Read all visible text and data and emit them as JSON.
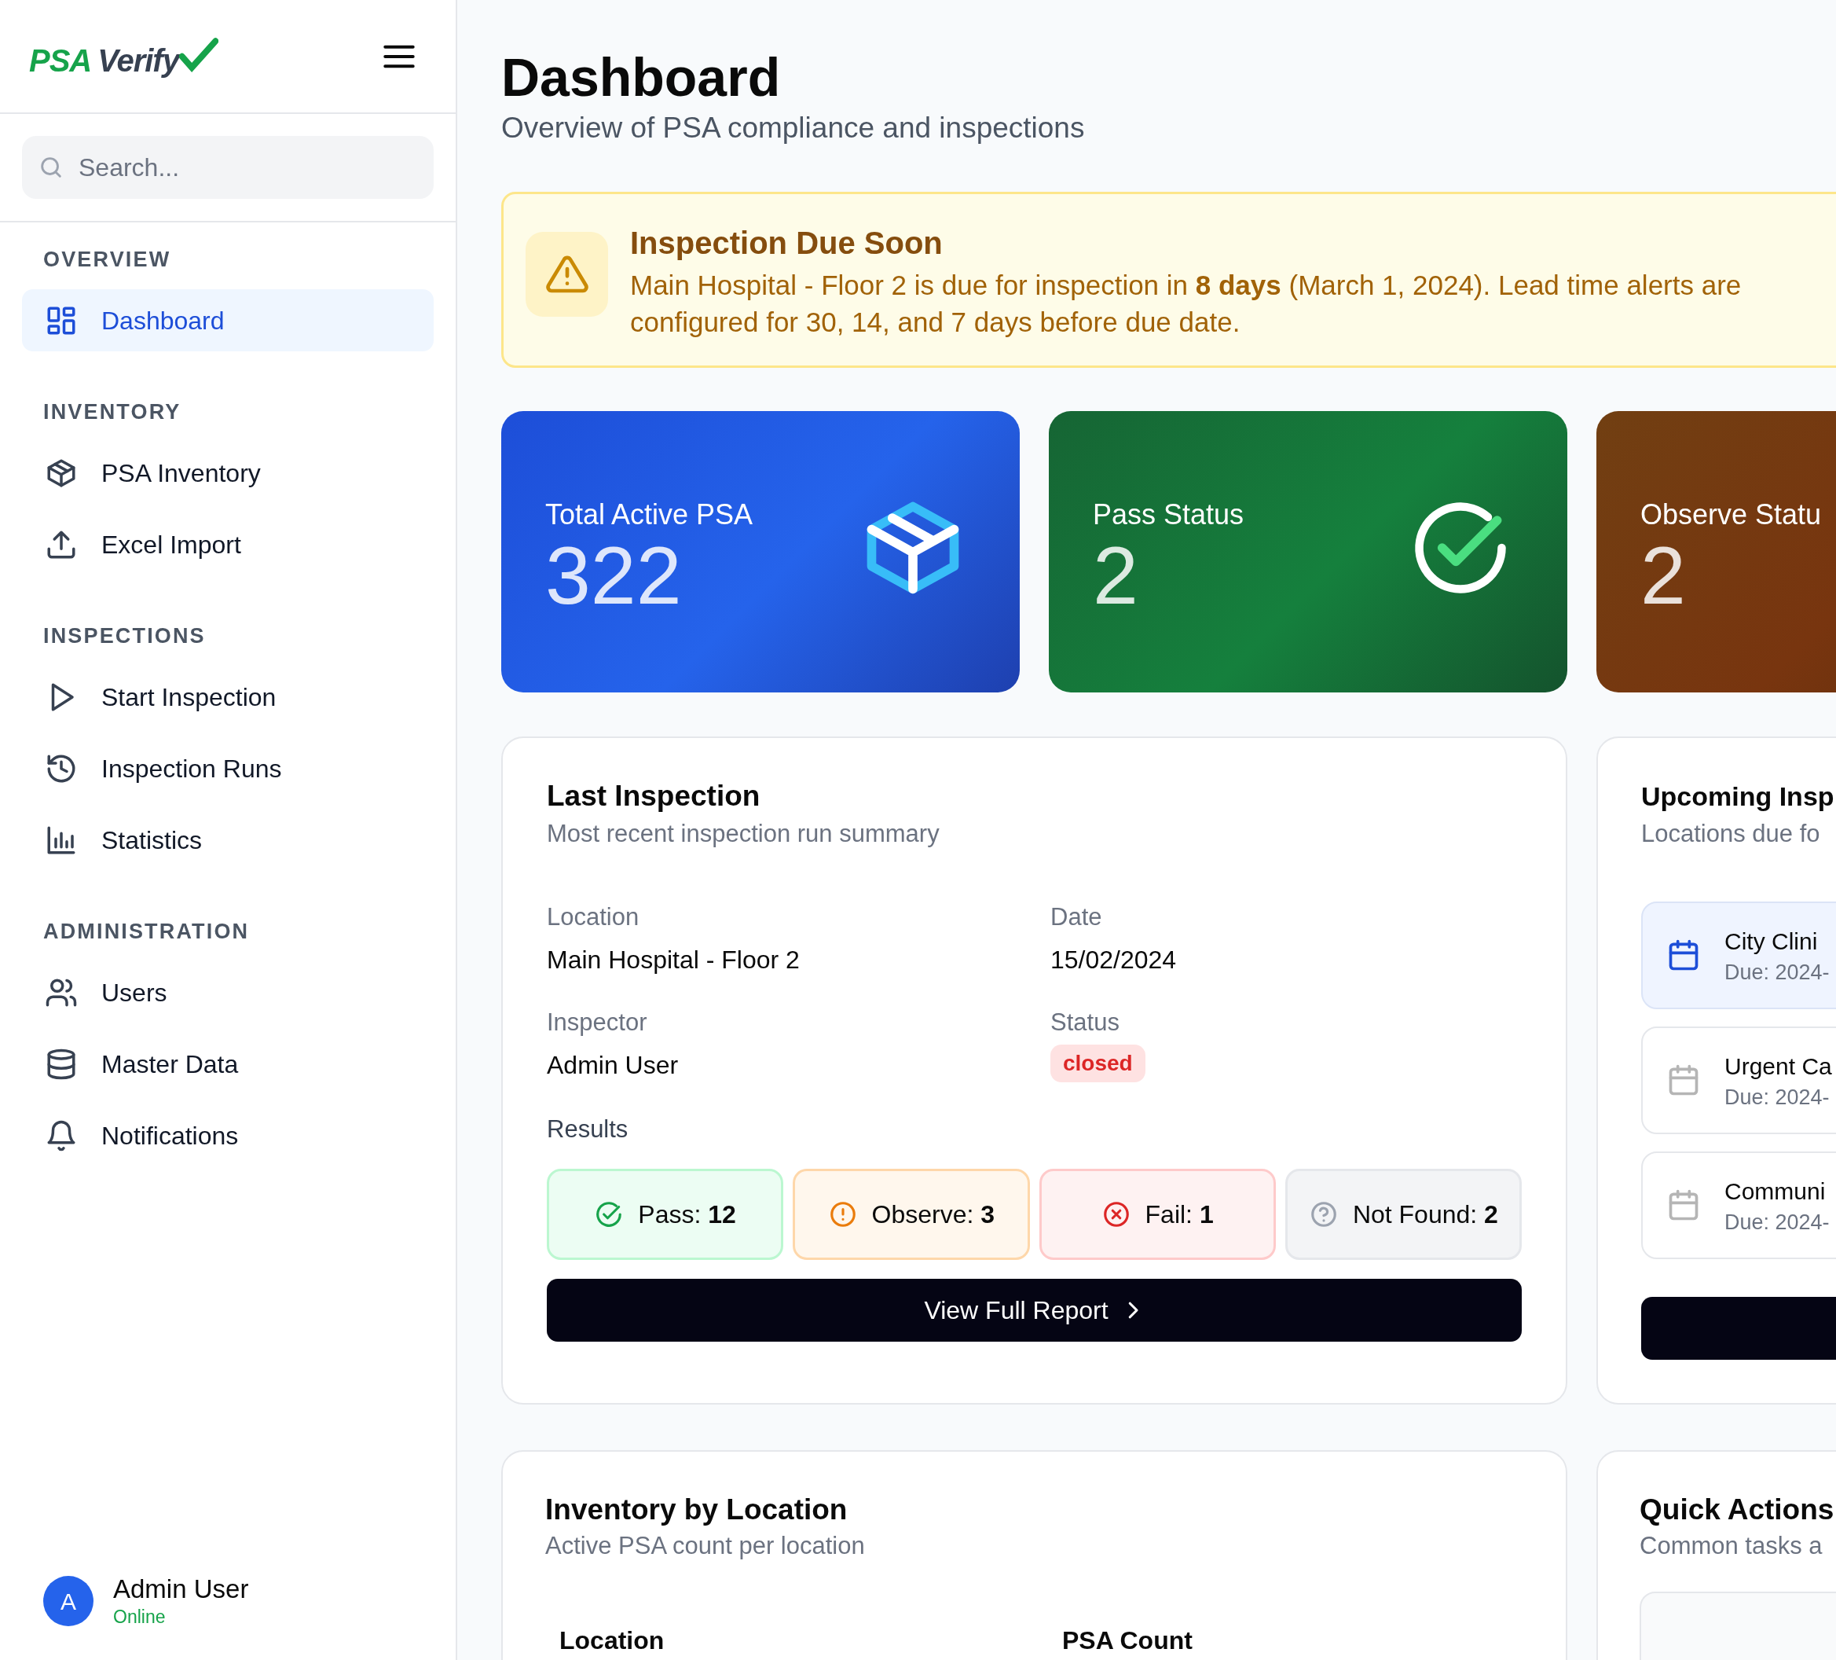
{
  "sidebar": {
    "logo": {
      "brand": "PSA",
      "product": "Verify"
    },
    "search": {
      "placeholder": "Search..."
    },
    "sections": [
      {
        "title": "OVERVIEW",
        "items": [
          {
            "label": "Dashboard",
            "kind": "grid",
            "selected": true
          }
        ]
      },
      {
        "title": "INVENTORY",
        "items": [
          {
            "label": "PSA Inventory",
            "kind": "box",
            "selected": false
          },
          {
            "label": "Excel Import",
            "kind": "upload",
            "selected": false
          }
        ]
      },
      {
        "title": "INSPECTIONS",
        "items": [
          {
            "label": "Start Inspection",
            "kind": "play",
            "selected": false
          },
          {
            "label": "Inspection Runs",
            "kind": "history",
            "selected": false
          },
          {
            "label": "Statistics",
            "kind": "chart",
            "selected": false
          }
        ]
      },
      {
        "title": "ADMINISTRATION",
        "items": [
          {
            "label": "Users",
            "kind": "users",
            "selected": false
          },
          {
            "label": "Master Data",
            "kind": "database",
            "selected": false
          },
          {
            "label": "Notifications",
            "kind": "bell",
            "selected": false
          }
        ]
      }
    ],
    "user": {
      "initial": "A",
      "name": "Admin User",
      "status": "Online"
    }
  },
  "header": {
    "title": "Dashboard",
    "subtitle": "Overview of PSA compliance and inspections"
  },
  "alert": {
    "title": "Inspection Due Soon",
    "message": "Main Hospital - Floor 2 is due for inspection in **8 days** (March 1, 2024). Lead time alerts are configured for 30, 14, and 7 days before due date."
  },
  "stats": [
    {
      "kind": "total",
      "label": "Total Active PSA",
      "value": "322"
    },
    {
      "kind": "pass",
      "label": "Pass Status",
      "value": "2"
    },
    {
      "kind": "observe",
      "label": "Observe Statu",
      "value": "2"
    }
  ],
  "last_inspection": {
    "title": "Last Inspection",
    "subtitle": "Most recent inspection run summary",
    "fields": [
      {
        "kind": "text",
        "label": "Location",
        "value": "Main Hospital - Floor 2"
      },
      {
        "kind": "text",
        "label": "Date",
        "value": "15/02/2024"
      },
      {
        "kind": "text",
        "label": "Inspector",
        "value": "Admin User"
      },
      {
        "kind": "badge",
        "label": "Status",
        "value": "closed"
      }
    ],
    "results_label": "Results",
    "results": [
      {
        "kind": "pass",
        "label": "Pass:",
        "count": "12"
      },
      {
        "kind": "observe",
        "label": "Observe:",
        "count": "3"
      },
      {
        "kind": "fail",
        "label": "Fail:",
        "count": "1"
      },
      {
        "kind": "not_found",
        "label": "Not Found:",
        "count": "2"
      }
    ],
    "button": "View Full Report"
  },
  "upcoming": {
    "title": "Upcoming Insp",
    "subtitle": "Locations due fo",
    "items": [
      {
        "name": "City Clini",
        "due": "Due: 2024-",
        "selected": true
      },
      {
        "name": "Urgent Ca",
        "due": "Due: 2024-",
        "selected": false
      },
      {
        "name": "Communi",
        "due": "Due: 2024-",
        "selected": false
      }
    ]
  },
  "inventory": {
    "title": "Inventory by Location",
    "subtitle": "Active PSA count per location",
    "columns": [
      "Location",
      "PSA Count"
    ]
  },
  "quick_actions": {
    "title": "Quick Actions",
    "subtitle": "Common tasks a"
  }
}
